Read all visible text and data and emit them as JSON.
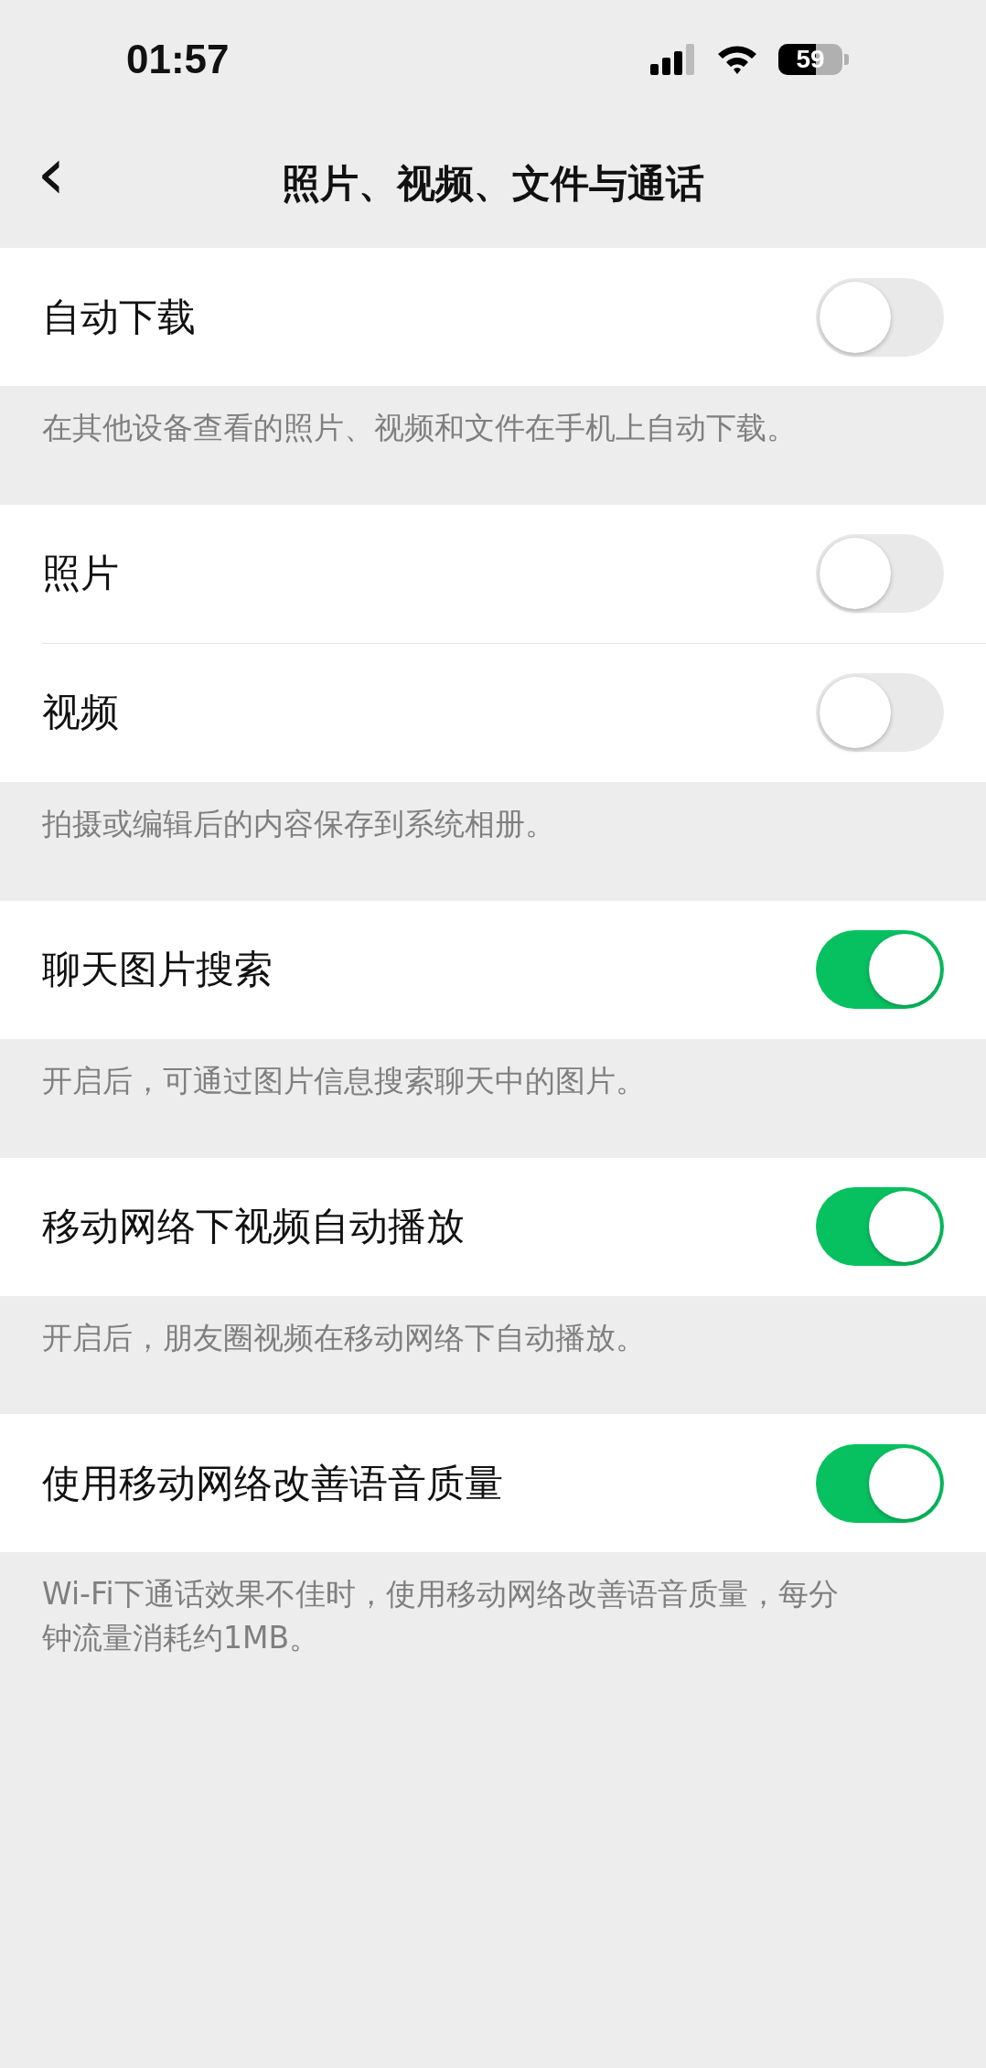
{
  "status_bar": {
    "time": "01:57",
    "battery": "59"
  },
  "nav": {
    "back": "‹",
    "title": "照片、视频、文件与通话"
  },
  "sections": [
    {
      "rows": [
        {
          "label": "自动下载",
          "on": false
        }
      ],
      "footnote": "在其他设备查看的照片、视频和文件在手机上自动下载。"
    },
    {
      "rows": [
        {
          "label": "照片",
          "on": false
        },
        {
          "label": "视频",
          "on": false
        }
      ],
      "footnote": "拍摄或编辑后的内容保存到系统相册。"
    },
    {
      "rows": [
        {
          "label": "聊天图片搜索",
          "on": true
        }
      ],
      "footnote": "开启后，可通过图片信息搜索聊天中的图片。"
    },
    {
      "rows": [
        {
          "label": "移动网络下视频自动播放",
          "on": true
        }
      ],
      "footnote": "开启后，朋友圈视频在移动网络下自动播放。"
    },
    {
      "rows": [
        {
          "label": "使用移动网络改善语音质量",
          "on": true
        }
      ],
      "footnote": "Wi-Fi下通话效果不佳时，使用移动网络改善语音质量，每分钟流量消耗约1MB。"
    }
  ]
}
